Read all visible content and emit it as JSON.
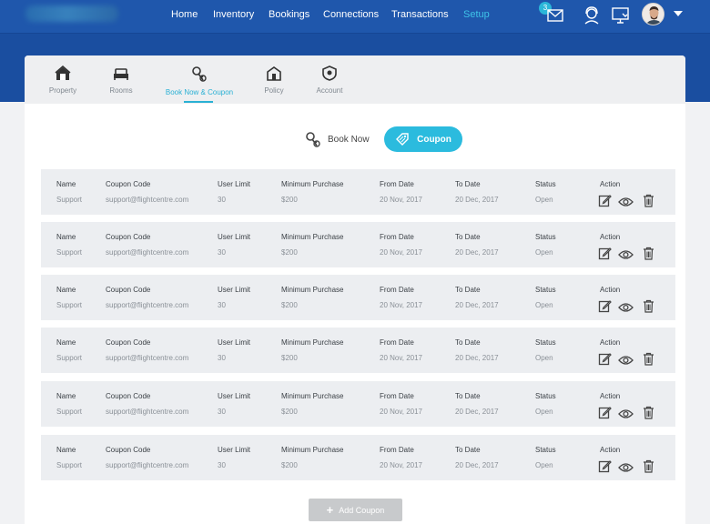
{
  "header": {
    "nav": [
      {
        "label": "Home",
        "active": false
      },
      {
        "label": "Inventory",
        "active": false
      },
      {
        "label": "Bookings",
        "active": false
      },
      {
        "label": "Connections",
        "active": false
      },
      {
        "label": "Transactions",
        "active": false
      },
      {
        "label": "Setup",
        "active": true
      }
    ],
    "notification_count": "3",
    "icons": [
      "mail-icon",
      "support-agent-icon",
      "monitor-icon",
      "user-avatar",
      "chevron-down-icon"
    ]
  },
  "tabs": [
    {
      "label": "Property",
      "icon": "property-icon"
    },
    {
      "label": "Rooms",
      "icon": "bed-icon"
    },
    {
      "label": "Book Now & Coupon",
      "icon": "keys-icon",
      "active": true
    },
    {
      "label": "Policy",
      "icon": "house-icon"
    },
    {
      "label": "Account",
      "icon": "shield-icon"
    }
  ],
  "toggle": {
    "book_now": "Book Now",
    "coupon": "Coupon",
    "selected": "Coupon"
  },
  "columns": [
    "Name",
    "Coupon Code",
    "User Limit",
    "Minimum Purchase",
    "From Date",
    "To Date",
    "Status",
    "Action"
  ],
  "coupons": [
    {
      "name": "Support",
      "code": "support@flightcentre.com",
      "limit": "30",
      "min": "$200",
      "from": "20 Nov, 2017",
      "to": "20 Dec, 2017",
      "status": "Open"
    },
    {
      "name": "Support",
      "code": "support@flightcentre.com",
      "limit": "30",
      "min": "$200",
      "from": "20 Nov, 2017",
      "to": "20 Dec, 2017",
      "status": "Open"
    },
    {
      "name": "Support",
      "code": "support@flightcentre.com",
      "limit": "30",
      "min": "$200",
      "from": "20 Nov, 2017",
      "to": "20 Dec, 2017",
      "status": "Open"
    },
    {
      "name": "Support",
      "code": "support@flightcentre.com",
      "limit": "30",
      "min": "$200",
      "from": "20 Nov, 2017",
      "to": "20 Dec, 2017",
      "status": "Open"
    },
    {
      "name": "Support",
      "code": "support@flightcentre.com",
      "limit": "30",
      "min": "$200",
      "from": "20 Nov, 2017",
      "to": "20 Dec, 2017",
      "status": "Open"
    },
    {
      "name": "Support",
      "code": "support@flightcentre.com",
      "limit": "30",
      "min": "$200",
      "from": "20 Nov, 2017",
      "to": "20 Dec, 2017",
      "status": "Open"
    }
  ],
  "row_actions": [
    "edit-icon",
    "view-icon",
    "delete-icon"
  ],
  "add_coupon_label": "Add Coupon",
  "colors": {
    "header_blue": "#1f57ac",
    "accent": "#2bbbde",
    "row_bg": "#eceef1",
    "disabled_button": "#c8cacc"
  }
}
